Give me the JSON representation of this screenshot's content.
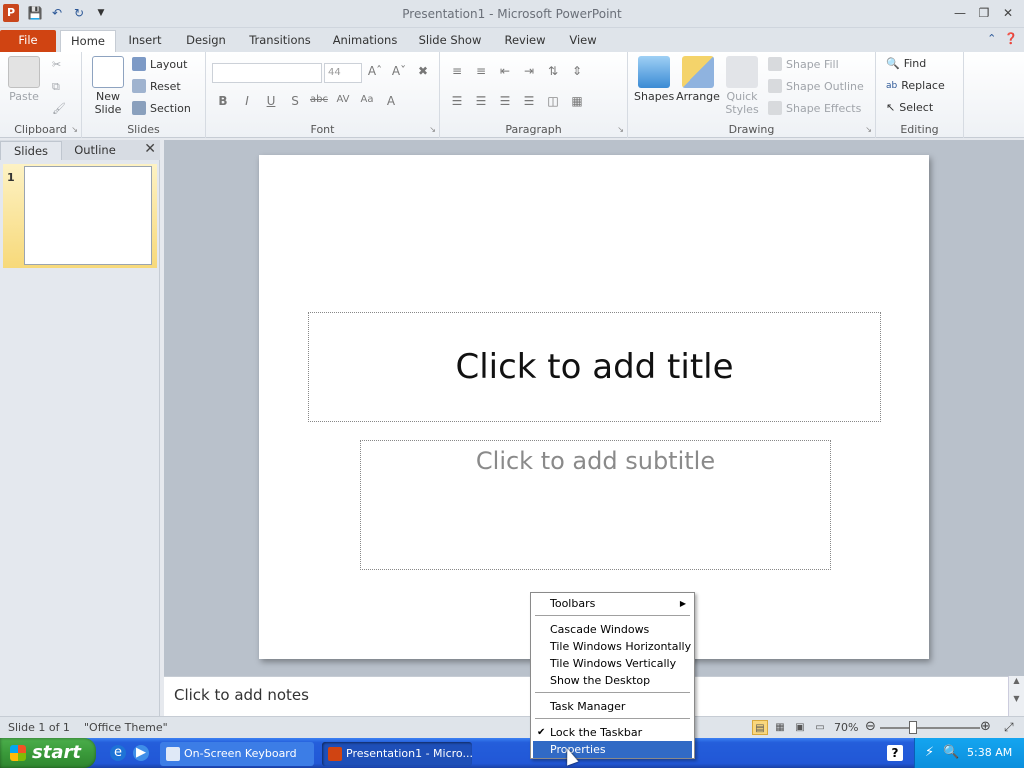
{
  "window": {
    "app_letter": "P",
    "title": "Presentation1  -  Microsoft PowerPoint"
  },
  "tabs": [
    "File",
    "Home",
    "Insert",
    "Design",
    "Transitions",
    "Animations",
    "Slide Show",
    "Review",
    "View"
  ],
  "ribbon": {
    "clipboard": {
      "label": "Clipboard",
      "paste": "Paste"
    },
    "slides": {
      "label": "Slides",
      "new_slide_1": "New",
      "new_slide_2": "Slide",
      "layout": "Layout",
      "reset": "Reset",
      "section": "Section"
    },
    "font": {
      "label": "Font",
      "size": "44"
    },
    "paragraph": {
      "label": "Paragraph"
    },
    "drawing": {
      "label": "Drawing",
      "shapes": "Shapes",
      "arrange": "Arrange",
      "quick_styles_1": "Quick",
      "quick_styles_2": "Styles",
      "shape_fill": "Shape Fill",
      "shape_outline": "Shape Outline",
      "shape_effects": "Shape Effects"
    },
    "editing": {
      "label": "Editing",
      "find": "Find",
      "replace": "Replace",
      "select": "Select"
    }
  },
  "panes": {
    "slides_tab": "Slides",
    "outline_tab": "Outline",
    "slide_number": "1"
  },
  "slide": {
    "title_placeholder": "Click to add title",
    "subtitle_placeholder": "Click to add subtitle"
  },
  "notes": {
    "placeholder": "Click to add notes"
  },
  "status": {
    "slide_info": "Slide 1 of 1",
    "theme": "\"Office Theme\"",
    "zoom": "70%"
  },
  "taskbar": {
    "start": "start",
    "items": [
      "On-Screen Keyboard",
      "Presentation1 - Micro..."
    ],
    "clock": "5:38 AM"
  },
  "context_menu": {
    "items": [
      {
        "label": "Toolbars"
      },
      {
        "label": "Cascade Windows"
      },
      {
        "label": "Tile Windows Horizontally"
      },
      {
        "label": "Tile Windows Vertically"
      },
      {
        "label": "Show the Desktop"
      },
      {
        "label": "Task Manager"
      },
      {
        "label": "Lock the Taskbar"
      },
      {
        "label": "Properties"
      }
    ]
  },
  "colors": {
    "file_tab": "#d04412",
    "selection": "#316ac5",
    "taskbar": "#245edb",
    "start": "#3a9a3a"
  }
}
